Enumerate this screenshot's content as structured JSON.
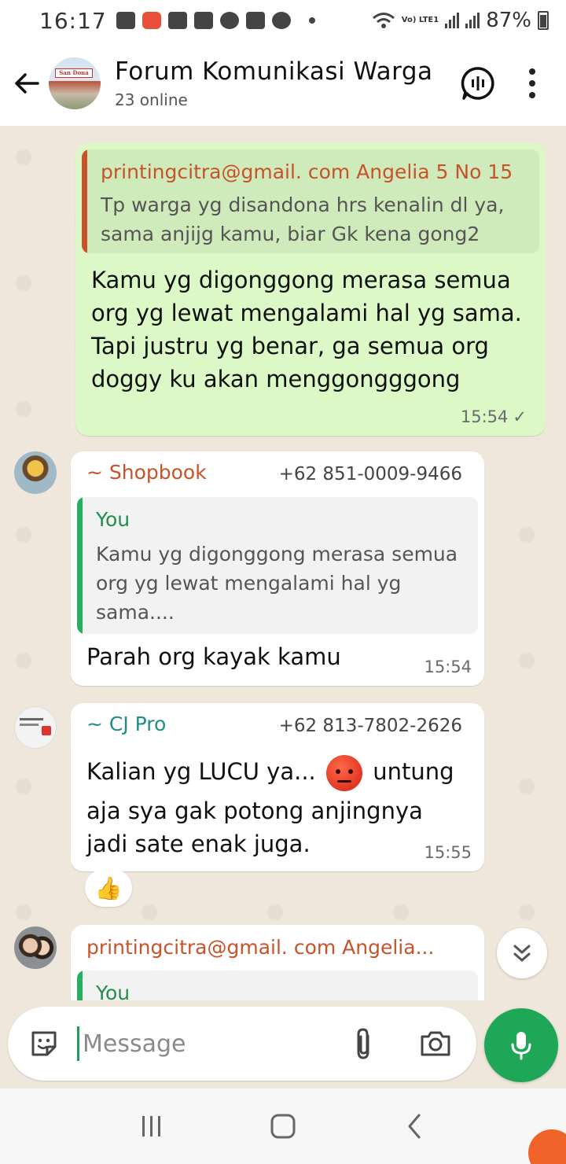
{
  "status_bar": {
    "time": "16:17",
    "network": "Vo) LTE1",
    "battery": "87%"
  },
  "header": {
    "title": "Forum Komunikasi Warga",
    "subtitle": "23 online",
    "avatar_text": "San Dona"
  },
  "messages": [
    {
      "type": "outgoing",
      "quote_author": "printingcitra@gmail. com Angelia 5 No 15",
      "quote_lines": [
        "Tp warga yg disandona hrs kenalin dl ya,",
        "sama anjijg kamu, biar Gk kena gong2"
      ],
      "text_lines": [
        "Kamu yg digonggong merasa semua",
        "org yg lewat mengalami hal yg sama.",
        "Tapi justru yg benar, ga semua org",
        "doggy ku akan menggongggong"
      ],
      "time": "15:54",
      "tick": "✓"
    },
    {
      "type": "incoming",
      "sender": "~ Shopbook",
      "phone": "+62 851-0009-9466",
      "quote_author": "You",
      "quote_lines": [
        "Kamu yg digonggong merasa semua",
        "org yg lewat mengalami hal yg",
        "sama...."
      ],
      "text": "Parah org kayak kamu",
      "time": "15:54"
    },
    {
      "type": "incoming",
      "sender": "~ CJ Pro",
      "phone": "+62 813-7802-2626",
      "text_part1": "Kalian yg LUCU ya...",
      "text_part2": "untung",
      "text_lines_rest": [
        "aja sya gak potong anjingnya",
        "jadi sate enak juga."
      ],
      "time": "15:55",
      "reaction": "👍"
    },
    {
      "type": "incoming",
      "sender": "printingcitra@gmail. com Angelia...",
      "quote_author": "You"
    }
  ],
  "composer": {
    "placeholder": "Message"
  },
  "colors": {
    "accent_green": "#1da756",
    "outgoing_bubble": "#dcf8c6",
    "chat_background": "#efe7dc",
    "sender_orange": "#c8532b",
    "sender_teal": "#1f8f86"
  }
}
